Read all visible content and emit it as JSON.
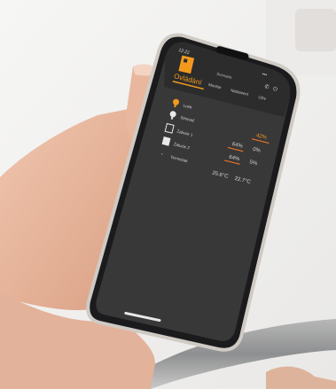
{
  "status_bar": {
    "time": "12:22",
    "signal": "▪▪▪"
  },
  "header": {
    "title": "Ovládání",
    "subtitle": "Scenario",
    "tabs": [
      "Ovládání",
      "Monitor",
      "Nastavení",
      "Uživ"
    ]
  },
  "devices": [
    {
      "icon": "lamp-icon",
      "label": "Lustr"
    },
    {
      "icon": "bulb-icon",
      "label": "Stmívač",
      "value": "42%"
    },
    {
      "icon": "blind-icon",
      "label": "Žaluzie 1",
      "value_a": "64%",
      "value_b": "0%"
    },
    {
      "icon": "blind-icon",
      "label": "Žaluzie 2",
      "value_a": "64%",
      "value_b": "5%"
    },
    {
      "icon": "thermostat-icon",
      "label": "Termostat",
      "value_a": "25.6°C",
      "value_b": "22.7°C"
    }
  ],
  "colors": {
    "accent": "#f39a1e",
    "screen": "#3a3a3a",
    "bar_orange": "#e8742a"
  }
}
